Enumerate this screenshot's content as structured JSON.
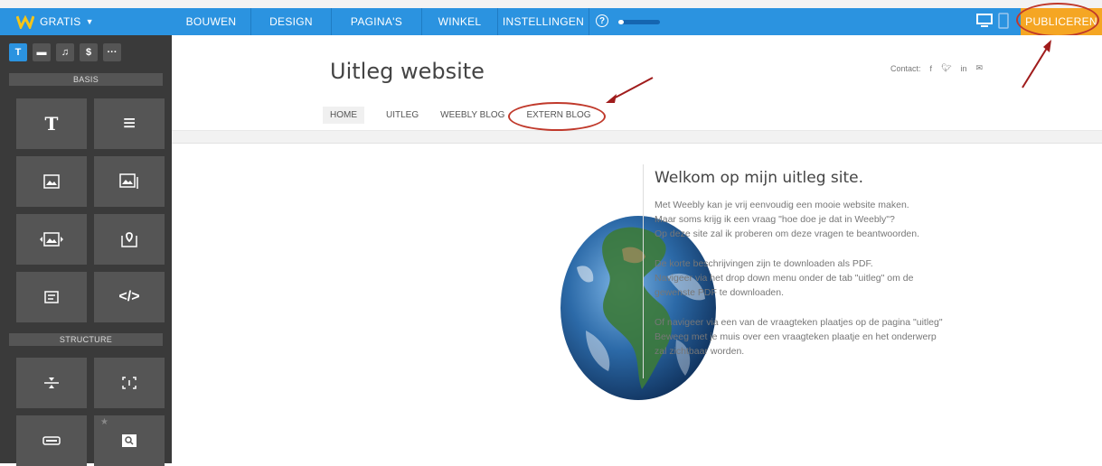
{
  "topbar": {
    "brand": "GRATIS",
    "tabs": [
      "BOUWEN",
      "DESIGN",
      "PAGINA'S",
      "WINKEL",
      "INSTELLINGEN"
    ],
    "help": "?",
    "publish": "PUBLICEREN",
    "colors": {
      "bar": "#2b93e0",
      "publish": "#f5a623"
    }
  },
  "sidebar": {
    "categories": [
      "T",
      "▬",
      "♫",
      "$",
      "···"
    ],
    "basis_label": "BASIS",
    "structure_label": "STRUCTURE",
    "tiles": [
      "T",
      "≡",
      "image-icon",
      "gallery-icon",
      "slideshow-icon",
      "map-icon",
      "form-icon",
      "</>",
      "divider-icon",
      "spacer-icon",
      "button-icon",
      "search-icon"
    ]
  },
  "site": {
    "title": "Uitleg website",
    "contact_label": "Contact:",
    "social": [
      "f",
      "𝕥",
      "in",
      "✉"
    ],
    "nav": [
      "HOME",
      "UITLEG",
      "WEEBLY BLOG",
      "EXTERN BLOG"
    ],
    "welcome": "Welkom op mijn uitleg site.",
    "paragraphs": [
      [
        "Met Weebly kan je vrij eenvoudig een mooie website maken.",
        "Maar soms krijg ik een vraag \"hoe doe je dat in Weebly\"?",
        "Op deze site zal ik proberen om deze vragen te beantwoorden."
      ],
      [
        "De korte beschrijvingen zijn te downloaden als PDF.",
        "Navigeer via het drop down menu onder de tab \"uitleg\" om de",
        "gewenste PDF te downloaden."
      ],
      [
        "Of navigeer via een van de vraagteken plaatjes op de pagina \"uitleg\"",
        "Beweeg met je muis over een vraagteken plaatje en het onderwerp",
        "zal zichtbaar worden."
      ]
    ]
  }
}
